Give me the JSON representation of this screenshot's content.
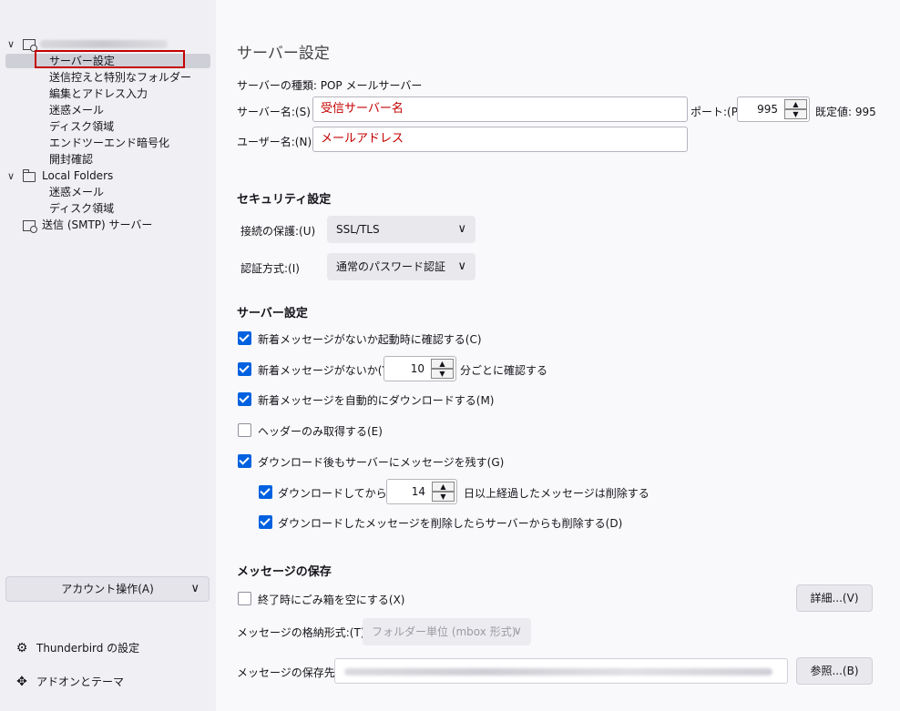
{
  "sidebar": {
    "account_items": [
      "サーバー設定",
      "送信控えと特別なフォルダー",
      "編集とアドレス入力",
      "迷惑メール",
      "ディスク領域",
      "エンドツーエンド暗号化",
      "開封確認"
    ],
    "local_folders": {
      "label": "Local Folders",
      "items": [
        "迷惑メール",
        "ディスク領域"
      ]
    },
    "smtp_label": "送信 (SMTP) サーバー",
    "account_actions": "アカウント操作(A)",
    "settings_label": "Thunderbird の設定",
    "addons_label": "アドオンとテーマ"
  },
  "main": {
    "title": "サーバー設定",
    "server_type": "サーバーの種類: POP メールサーバー",
    "server_name_label": "サーバー名:(S)",
    "server_name_value": "受信サーバー名",
    "port_label": "ポート:(P)",
    "port_value": "995",
    "default_port": "既定値: 995",
    "username_label": "ユーザー名:(N)",
    "username_value": "メールアドレス",
    "security_heading": "セキュリティ設定",
    "conn_security_label": "接続の保護:(U)",
    "conn_security_value": "SSL/TLS",
    "auth_label": "認証方式:(I)",
    "auth_value": "通常のパスワード認証",
    "server_heading": "サーバー設定",
    "opt_check_startup": "新着メッセージがないか起動時に確認する(C)",
    "opt_check_every_pre": "新着メッセージがないか(Y)",
    "opt_check_every_value": "10",
    "opt_check_every_post": "分ごとに確認する",
    "opt_auto_download": "新着メッセージを自動的にダウンロードする(M)",
    "opt_headers_only": "ヘッダーのみ取得する(E)",
    "opt_leave_on_server": "ダウンロード後もサーバーにメッセージを残す(G)",
    "opt_delete_after_pre": "ダウンロードしてから(O)",
    "opt_delete_after_value": "14",
    "opt_delete_after_post": "日以上経過したメッセージは削除する",
    "opt_delete_from_server": "ダウンロードしたメッセージを削除したらサーバーからも削除する(D)",
    "storage_heading": "メッセージの保存",
    "opt_empty_trash": "終了時にごみ箱を空にする(X)",
    "advanced_button": "詳細...(V)",
    "store_type_label": "メッセージの格納形式:(T)",
    "store_type_value": "フォルダー単位 (mbox 形式)",
    "store_dir_label": "メッセージの保存先:",
    "browse_button": "参照...(B)"
  },
  "colors": {
    "accent": "#0061e0",
    "highlight_red": "#c40000"
  }
}
